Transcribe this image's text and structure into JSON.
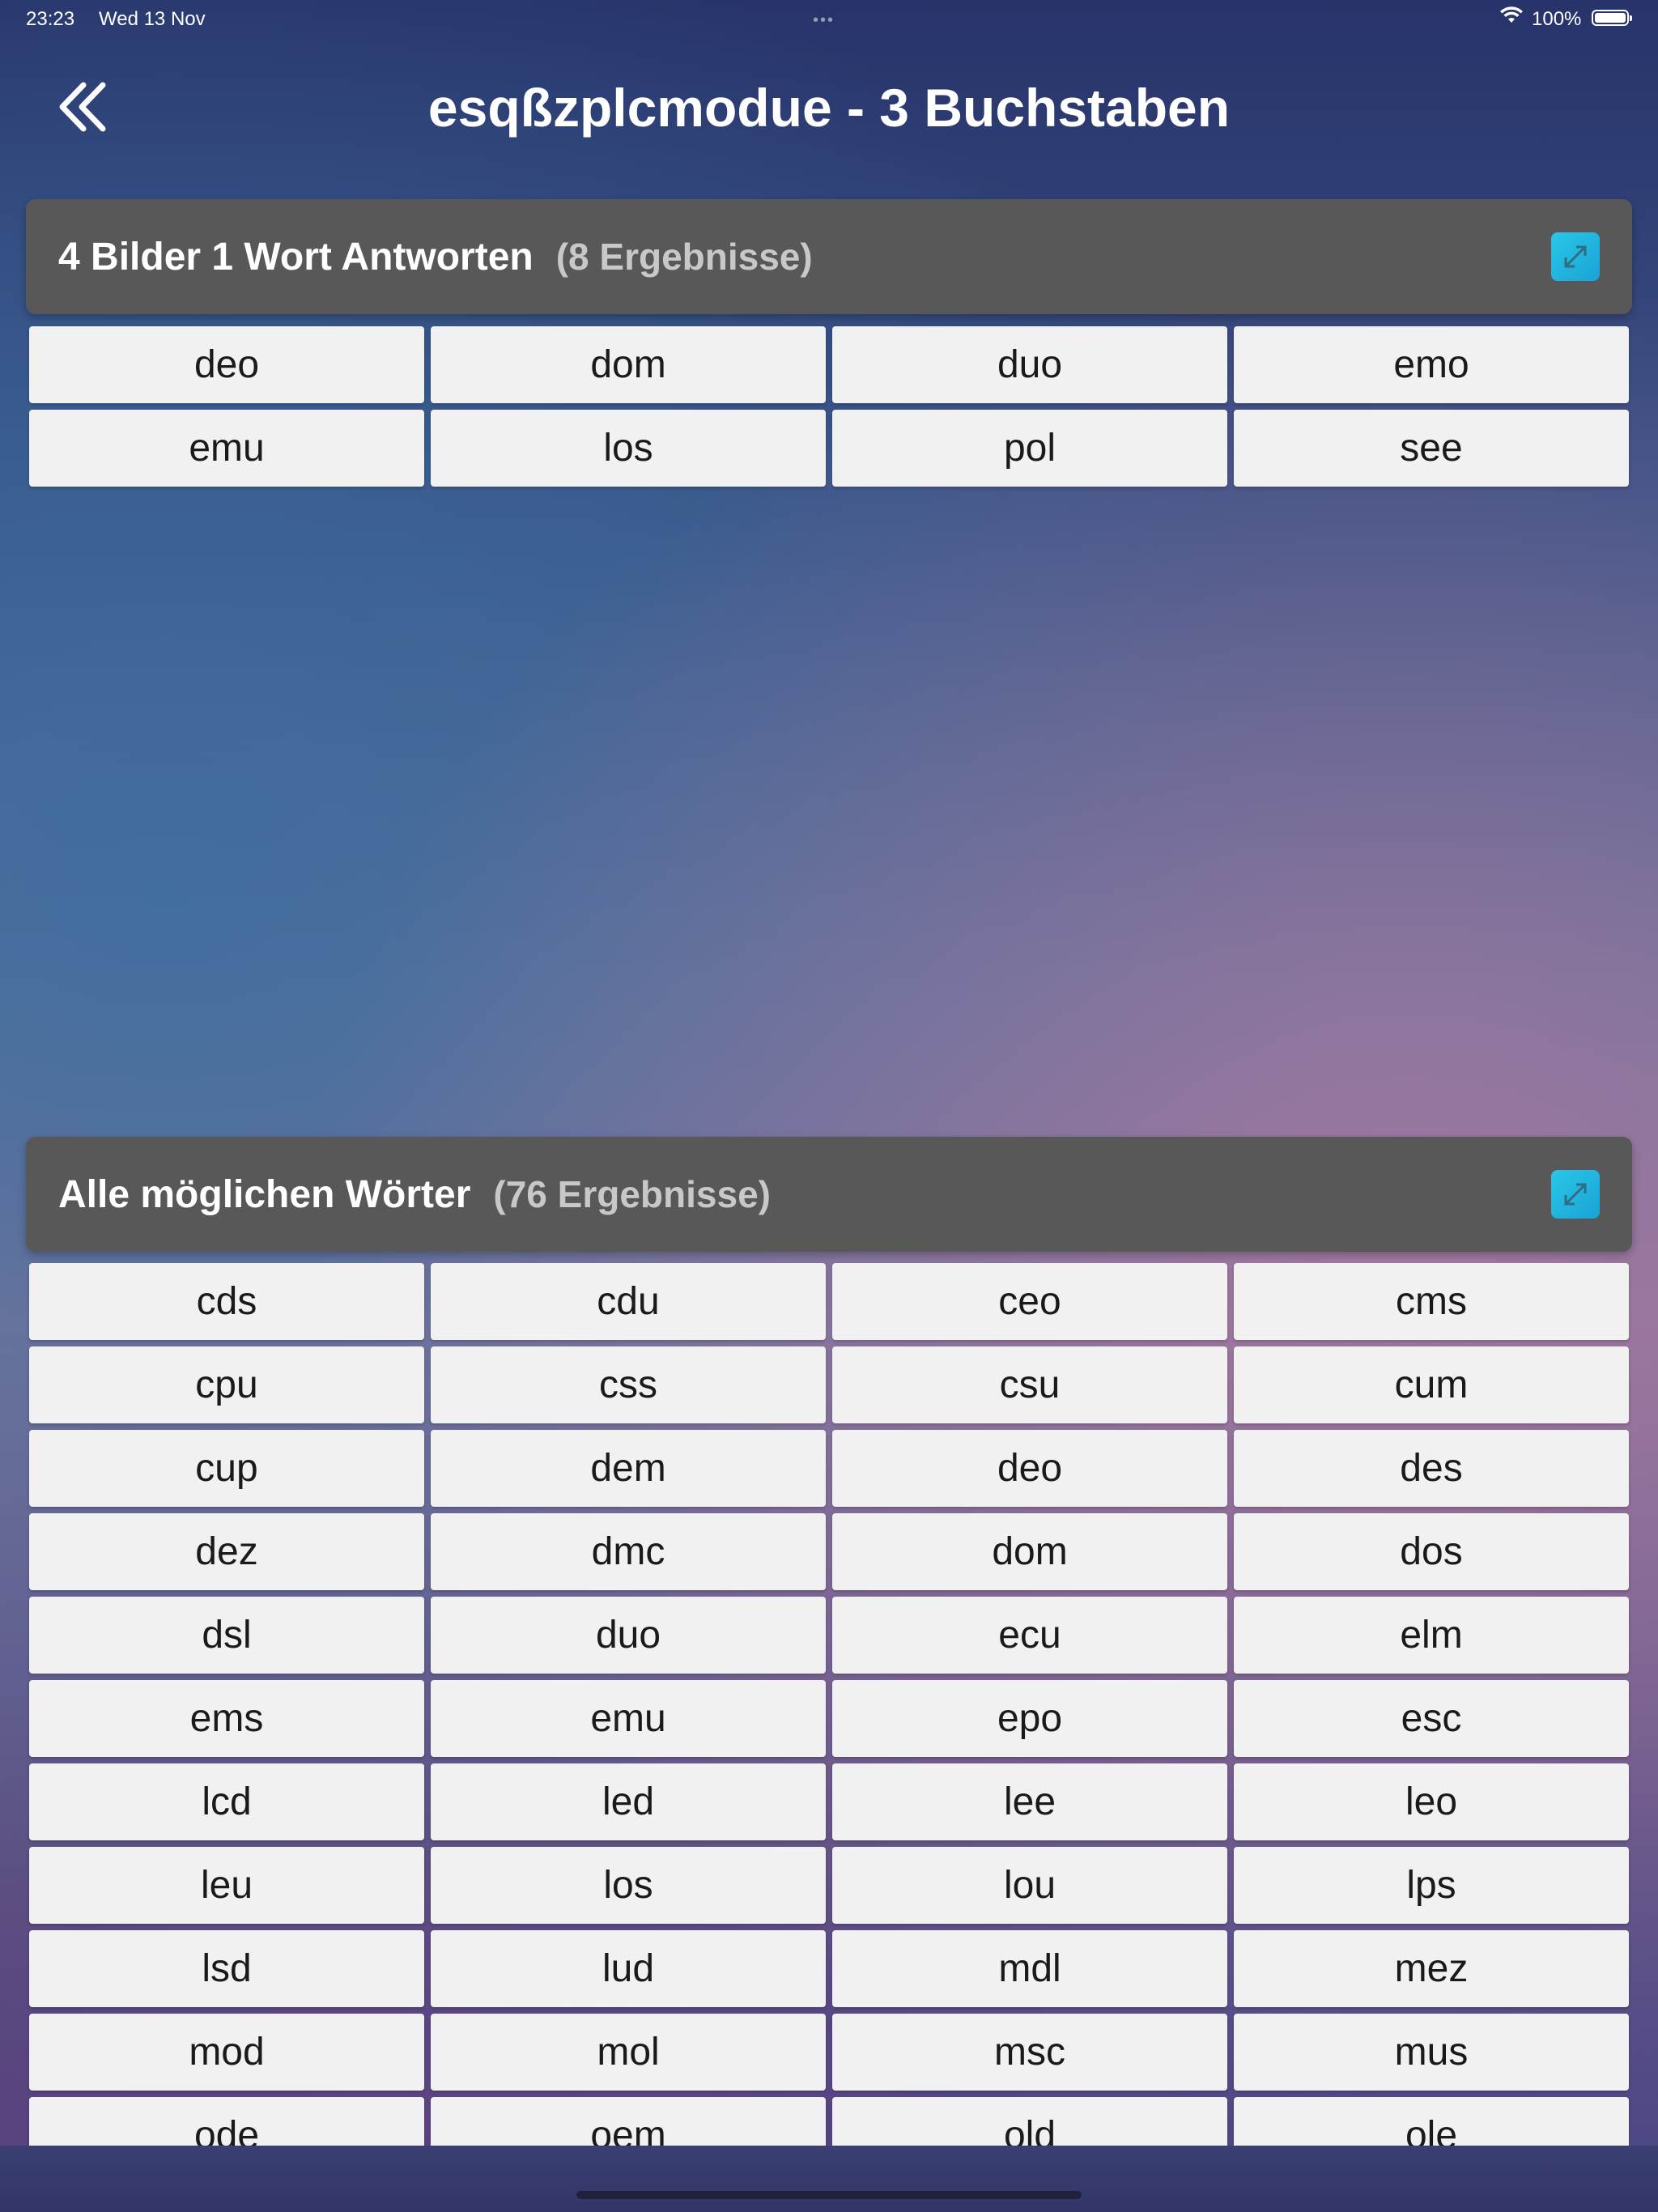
{
  "status_bar": {
    "time": "23:23",
    "date": "Wed 13 Nov",
    "battery": "100%"
  },
  "header": {
    "title": "esqßzplcmodue - 3 Buchstaben"
  },
  "answers": {
    "title": "4 Bilder 1 Wort Antworten",
    "count": "(8 Ergebnisse)",
    "words": [
      "deo",
      "dom",
      "duo",
      "emo",
      "emu",
      "los",
      "pol",
      "see"
    ]
  },
  "all_words": {
    "title": "Alle möglichen Wörter",
    "count": "(76 Ergebnisse)",
    "words": [
      "cds",
      "cdu",
      "ceo",
      "cms",
      "cpu",
      "css",
      "csu",
      "cum",
      "cup",
      "dem",
      "deo",
      "des",
      "dez",
      "dmc",
      "dom",
      "dos",
      "dsl",
      "duo",
      "ecu",
      "elm",
      "ems",
      "emu",
      "epo",
      "esc",
      "lcd",
      "led",
      "lee",
      "leo",
      "leu",
      "los",
      "lou",
      "lps",
      "lsd",
      "lud",
      "mdl",
      "mez",
      "mod",
      "mol",
      "msc",
      "mus",
      "ode",
      "oem",
      "old",
      "ole"
    ]
  },
  "colors": {
    "header_bg": "#585858",
    "accent": "#22b6e0",
    "cell_bg": "#f1f1f1"
  }
}
